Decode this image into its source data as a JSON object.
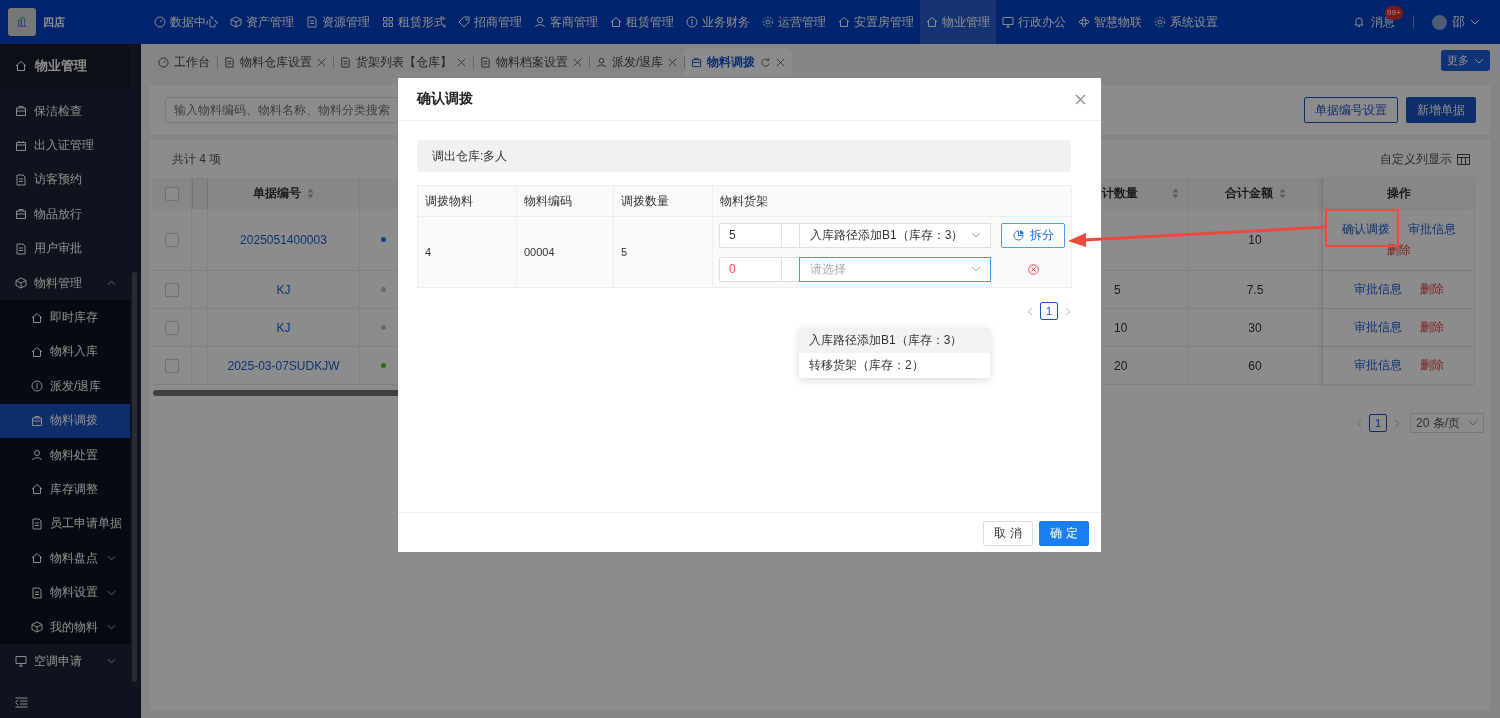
{
  "header": {
    "store": "四店",
    "nav": [
      {
        "label": "数据中心",
        "selected": false
      },
      {
        "label": "资产管理",
        "selected": false
      },
      {
        "label": "资源管理",
        "selected": false
      },
      {
        "label": "租赁形式",
        "selected": false
      },
      {
        "label": "招商管理",
        "selected": false
      },
      {
        "label": "客商管理",
        "selected": false
      },
      {
        "label": "租赁管理",
        "selected": false
      },
      {
        "label": "业务财务",
        "selected": false
      },
      {
        "label": "运营管理",
        "selected": false
      },
      {
        "label": "安置房管理",
        "selected": false
      },
      {
        "label": "物业管理",
        "selected": true
      },
      {
        "label": "行政办公",
        "selected": false
      },
      {
        "label": "智慧物联",
        "selected": false
      },
      {
        "label": "系统设置",
        "selected": false
      }
    ],
    "notifications": {
      "label": "消息",
      "badge": "99+"
    },
    "user": {
      "name": "邵"
    }
  },
  "sidebar": {
    "title": "物业管理",
    "items": [
      {
        "label": "保洁检查",
        "kind": "link",
        "selected": false
      },
      {
        "label": "出入证管理",
        "kind": "link",
        "selected": false
      },
      {
        "label": "访客预约",
        "kind": "link",
        "selected": false
      },
      {
        "label": "物品放行",
        "kind": "link",
        "selected": false
      },
      {
        "label": "用户审批",
        "kind": "link",
        "selected": false
      },
      {
        "label": "物料管理",
        "kind": "group",
        "selected": false,
        "expanded": true,
        "children": [
          {
            "label": "即时库存",
            "kind": "link",
            "selected": false
          },
          {
            "label": "物料入库",
            "kind": "link",
            "selected": false
          },
          {
            "label": "派发/退库",
            "kind": "link",
            "selected": false
          },
          {
            "label": "物料调拨",
            "kind": "link",
            "selected": true
          },
          {
            "label": "物料处置",
            "kind": "link",
            "selected": false
          },
          {
            "label": "库存调整",
            "kind": "link",
            "selected": false
          },
          {
            "label": "员工申请单据",
            "kind": "link",
            "selected": false
          },
          {
            "label": "物料盘点",
            "kind": "group",
            "selected": false,
            "expanded": false
          },
          {
            "label": "物料设置",
            "kind": "group",
            "selected": false,
            "expanded": false
          },
          {
            "label": "我的物料",
            "kind": "group",
            "selected": false,
            "expanded": false
          }
        ]
      },
      {
        "label": "空调申请",
        "kind": "group",
        "selected": false,
        "expanded": false
      }
    ]
  },
  "tabs": [
    {
      "label": "工作台",
      "selected": false,
      "closable": false
    },
    {
      "label": "物料仓库设置",
      "selected": false,
      "closable": true
    },
    {
      "label": "货架列表【仓库】",
      "selected": false,
      "closable": true
    },
    {
      "label": "物料档案设置",
      "selected": false,
      "closable": true
    },
    {
      "label": "派发/退库",
      "selected": false,
      "closable": true
    },
    {
      "label": "物料调拨",
      "selected": true,
      "closable": true
    }
  ],
  "more_button": "更多",
  "page": {
    "search": {
      "placeholder": "输入物料编码、物料名称、物料分类搜索"
    },
    "buttons": [
      {
        "label": "单据编号设置",
        "kind": "secondary"
      },
      {
        "label": "新增单据",
        "kind": "primary"
      }
    ],
    "total": "共计 4 项",
    "column_settings": "自定义列显示",
    "table": {
      "all_selected": false,
      "columns": [
        {
          "label": "单据编号",
          "sortable": true
        },
        {
          "label": "计数量",
          "sortable": true
        },
        {
          "label": "合计金额",
          "sortable": true
        },
        {
          "label": "操作",
          "sortable": false
        }
      ],
      "rows": [
        {
          "selected": false,
          "number": "2025051400003",
          "color": "#0c418c",
          "amount": "10",
          "actions": [
            {
              "label": "确认调拨",
              "kind": "link"
            },
            {
              "label": "审批信息",
              "kind": "link"
            },
            {
              "label": "删除",
              "kind": "danger"
            }
          ]
        },
        {
          "selected": false,
          "number": "KJ",
          "color": "#696969",
          "quantity": "5",
          "amount": "7.5",
          "actions": [
            {
              "label": "审批信息",
              "kind": "link"
            },
            {
              "label": "删除",
              "kind": "danger"
            }
          ]
        },
        {
          "selected": false,
          "number": "KJ",
          "color": "#696969",
          "quantity": "10",
          "amount": "30",
          "actions": [
            {
              "label": "审批信息",
              "kind": "link"
            },
            {
              "label": "删除",
              "kind": "danger"
            }
          ]
        },
        {
          "selected": false,
          "number": "2025-03-07SUDKJW",
          "color": "#2d6c0e",
          "quantity": "20",
          "amount": "60",
          "actions": [
            {
              "label": "审批信息",
              "kind": "link"
            },
            {
              "label": "删除",
              "kind": "danger"
            }
          ]
        }
      ]
    },
    "pagination": {
      "current": "1",
      "page_size": "20 条/页"
    }
  },
  "modal": {
    "title": "确认调拨",
    "source": "调出仓库:多人",
    "columns": [
      "调拨物料",
      "物料编码",
      "调拨数量",
      "物料货架"
    ],
    "rows": [
      {
        "material": "4",
        "code": "00004",
        "quantity": "5",
        "allocations": [
          {
            "quantity": "5",
            "shelf": "入库路径添加B1（库存：3）",
            "focused": false,
            "invalid": false
          },
          {
            "quantity": "0",
            "placeholder": "请选择",
            "focused": true,
            "invalid": true
          }
        ]
      }
    ],
    "split_button": "拆分",
    "dropdown": [
      {
        "label": "入库路径添加B1（库存：3）",
        "selected": true
      },
      {
        "label": "转移货架（库存：2）",
        "selected": false
      }
    ],
    "pagination": {
      "current": "1"
    },
    "cancel_button": "取 消",
    "ok_button": "确 定"
  }
}
